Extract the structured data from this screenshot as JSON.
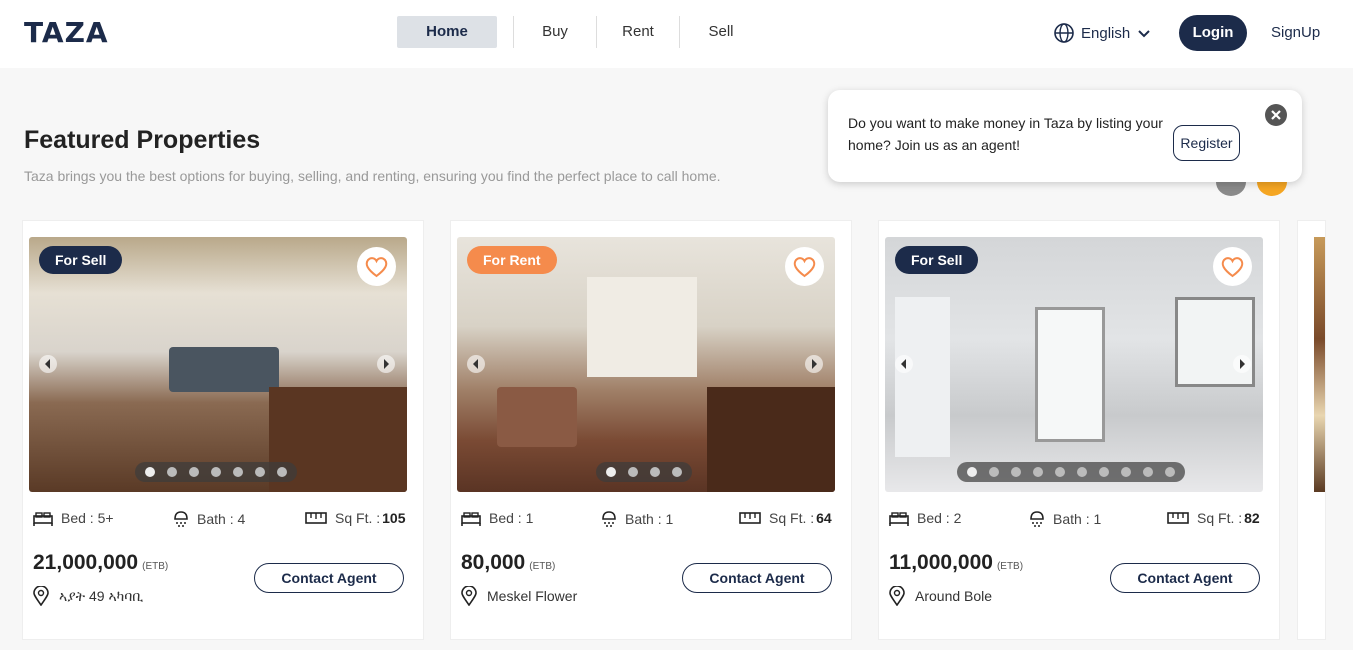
{
  "header": {
    "logo": "TAZA",
    "nav": [
      "Home",
      "Buy",
      "Rent",
      "Sell"
    ],
    "language": "English",
    "login": "Login",
    "signup": "SignUp"
  },
  "section": {
    "title": "Featured Properties",
    "subtitle": "Taza brings you the best options for buying, selling, and renting, ensuring you find the perfect place to call home."
  },
  "popup": {
    "text": "Do you want to make money in Taza by listing your home? Join us as an agent!",
    "register": "Register"
  },
  "cards": [
    {
      "badge": "For Sell",
      "bed": "Bed : 5+",
      "bath": "Bath : 4",
      "sqft_label": "Sq Ft. :",
      "sqft": "105",
      "price": "21,000,000",
      "currency": "(ETB)",
      "contact": "Contact Agent",
      "location": "ኣያት 49 ኣካባቢ",
      "photos": 7
    },
    {
      "badge": "For Rent",
      "bed": "Bed : 1",
      "bath": "Bath : 1",
      "sqft_label": "Sq Ft. :",
      "sqft": "64",
      "price": "80,000",
      "currency": "(ETB)",
      "contact": "Contact Agent",
      "location": "Meskel Flower",
      "photos": 4
    },
    {
      "badge": "For Sell",
      "bed": "Bed : 2",
      "bath": "Bath : 1",
      "sqft_label": "Sq Ft. :",
      "sqft": "82",
      "price": "11,000,000",
      "currency": "(ETB)",
      "contact": "Contact Agent",
      "location": "Around Bole",
      "photos": 10
    }
  ],
  "colors": {
    "navy": "#1c2b4a",
    "rent_badge": "#f58b4c",
    "accent": "#f5a623"
  },
  "icons": [
    "globe-icon",
    "chevron-down-icon",
    "close-icon",
    "heart-icon",
    "bed-icon",
    "shower-icon",
    "ruler-icon",
    "location-pin-icon",
    "chevron-left-icon",
    "chevron-right-icon"
  ]
}
